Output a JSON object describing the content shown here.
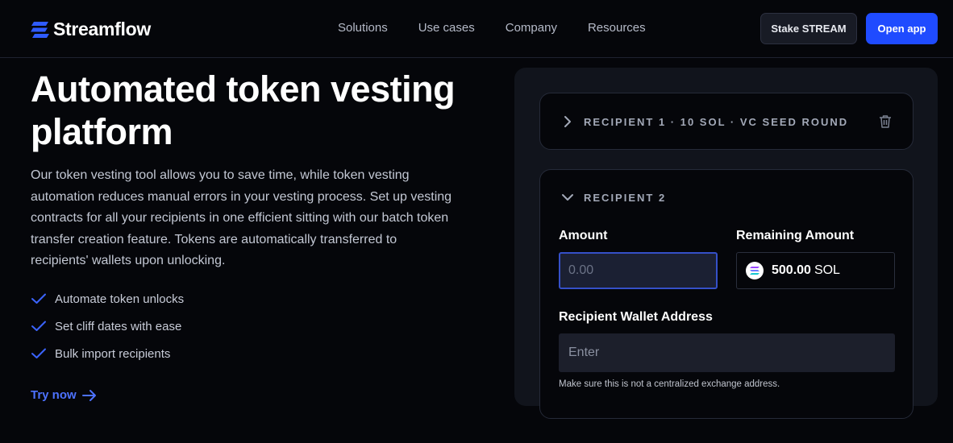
{
  "header": {
    "brand": "Streamflow",
    "nav": [
      "Solutions",
      "Use cases",
      "Company",
      "Resources"
    ],
    "stake_label": "Stake STREAM",
    "open_app_label": "Open app"
  },
  "hero": {
    "title": "Automated token vesting platform",
    "description": "Our token vesting tool allows you to save time, while token vesting automation reduces manual errors in your vesting process. Set up vesting contracts for all your recipients in one efficient sitting with our batch token transfer creation feature. Tokens are automatically transferred to recipients' wallets upon unlocking.",
    "features": [
      "Automate token unlocks",
      "Set cliff dates with ease",
      "Bulk import recipients"
    ],
    "cta_label": "Try now"
  },
  "form": {
    "recipient1_label": "RECIPIENT 1 · 10 SOL · VC SEED ROUND",
    "recipient2_label": "RECIPIENT 2",
    "amount_label": "Amount",
    "amount_placeholder": "0.00",
    "remaining_label": "Remaining Amount",
    "remaining_value": "500.00",
    "remaining_unit": "SOL",
    "wallet_label": "Recipient Wallet Address",
    "wallet_placeholder": "Enter",
    "wallet_hint": "Make sure this is not a centralized exchange address."
  },
  "colors": {
    "background": "#05060a",
    "accent": "#1f4bff",
    "link": "#4d72ff",
    "check": "#3b64ff"
  },
  "icons": [
    "streamflow-logo-icon",
    "check-icon",
    "arrow-right-icon",
    "chevron-right-icon",
    "chevron-down-icon",
    "trash-icon",
    "solana-icon"
  ]
}
